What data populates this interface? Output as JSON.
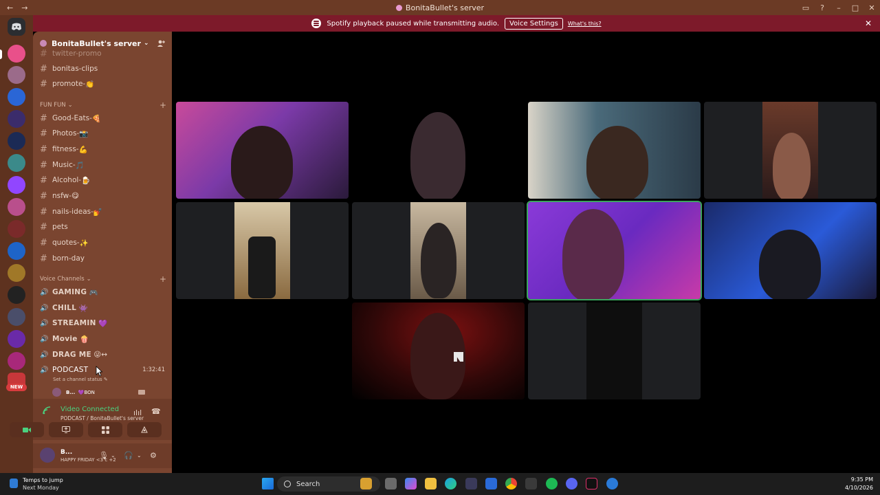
{
  "window": {
    "title": "BonitaBullet's server",
    "nav_back": "←",
    "nav_forward": "→"
  },
  "notice": {
    "text": "Spotify playback paused while transmitting audio.",
    "button": "Voice Settings",
    "link": "What's this?"
  },
  "server": {
    "name": "BonitaBullet's server"
  },
  "channels": {
    "partial_top": "twitter-promo",
    "top": [
      {
        "name": "bonitas-clips"
      },
      {
        "name": "promote-",
        "emoji": "👏"
      }
    ],
    "fun_category": "FUN FUN",
    "fun": [
      {
        "name": "Good-Eats-",
        "emoji": "🍕"
      },
      {
        "name": "Photos-",
        "emoji": "📸"
      },
      {
        "name": "fitness-",
        "emoji": "💪"
      },
      {
        "name": "Music-",
        "emoji": "🎵"
      },
      {
        "name": "Alcohol-",
        "emoji": "🍺"
      },
      {
        "name": "nsfw-",
        "emoji": "😋"
      },
      {
        "name": "nails-ideas-",
        "emoji": "💅"
      },
      {
        "name": "pets"
      },
      {
        "name": "quotes-",
        "emoji": "✨"
      },
      {
        "name": "born-day"
      }
    ],
    "voice_category": "Voice Channels",
    "voice": [
      {
        "name": "GAMING",
        "emoji": "🎮"
      },
      {
        "name": "CHILL",
        "emoji": "👾"
      },
      {
        "name": "STREAMIN",
        "emoji": "💜"
      },
      {
        "name": "Movie",
        "emoji": "🍿"
      },
      {
        "name": "DRAG ME",
        "emoji": "😜↔"
      }
    ],
    "podcast": {
      "name": "PODCAST",
      "duration": "1:32:41",
      "status_hint": "Set a channel status",
      "member": "B...",
      "member_tag": "💜BON"
    }
  },
  "voice_connection": {
    "status": "Video Connected",
    "location": "PODCAST / BonitaBullet's server"
  },
  "user": {
    "name": "B...",
    "status": "HAPPY FRIDAY <3 c +2"
  },
  "taskbar": {
    "weather_line1": "Temps to jump",
    "weather_line2": "Next Monday",
    "search": "Search",
    "time": "9:35 PM",
    "date": "4/10/2026"
  },
  "colors": {
    "accent_green": "#3ba55d",
    "banner_red": "#7d1a2a",
    "sidebar_brown": "#7a4530"
  }
}
